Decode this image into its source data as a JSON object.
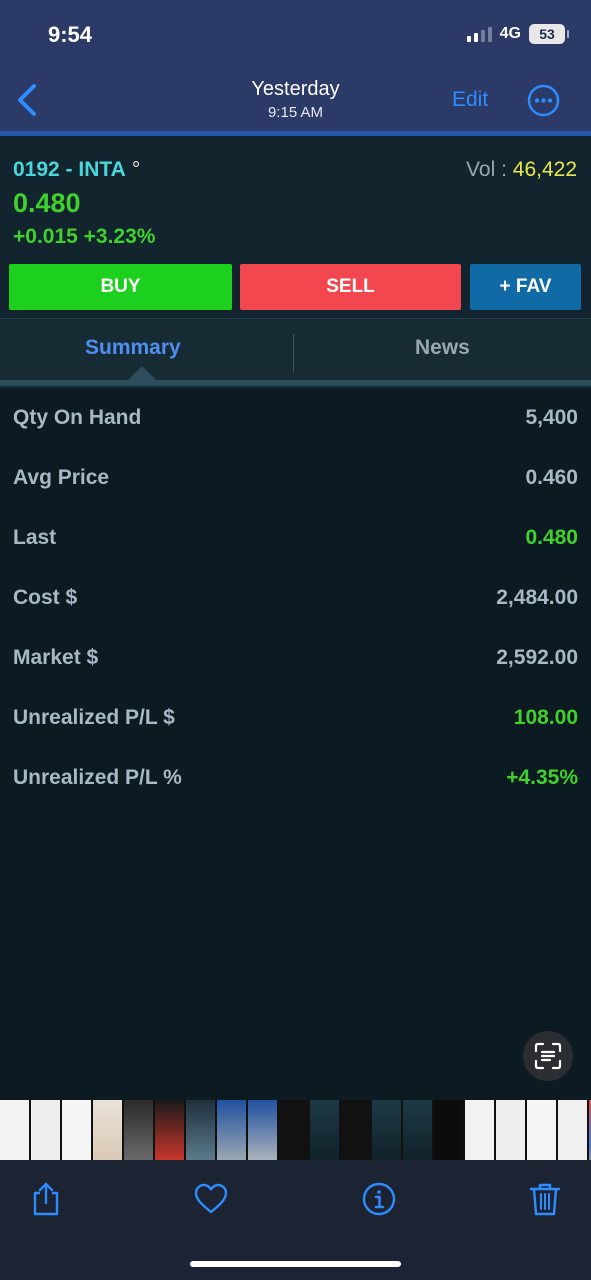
{
  "status_bar": {
    "time": "9:54",
    "network": "4G",
    "battery": "53"
  },
  "nav": {
    "title": "Yesterday",
    "subtitle": "9:15 AM",
    "edit_label": "Edit"
  },
  "quote": {
    "symbol": "0192 - INTA",
    "symbol_mark": "°",
    "vol_label": "Vol :",
    "vol_value": "46,422",
    "price": "0.480",
    "change": "+0.015 +3.23%"
  },
  "actions": {
    "buy": "BUY",
    "sell": "SELL",
    "fav": "+ FAV"
  },
  "tabs": {
    "summary": "Summary",
    "news": "News"
  },
  "summary": [
    {
      "label": "Qty On Hand",
      "value": "5,400",
      "positive": false
    },
    {
      "label": "Avg Price",
      "value": "0.460",
      "positive": false
    },
    {
      "label": "Last",
      "value": "0.480",
      "positive": true
    },
    {
      "label": "Cost $",
      "value": "2,484.00",
      "positive": false
    },
    {
      "label": "Market $",
      "value": "2,592.00",
      "positive": false
    },
    {
      "label": "Unrealized P/L $",
      "value": "108.00",
      "positive": true
    },
    {
      "label": "Unrealized P/L %",
      "value": "+4.35%",
      "positive": true
    }
  ],
  "toolbar_icons": [
    "share-icon",
    "heart-icon",
    "info-icon",
    "trash-icon"
  ],
  "colors": {
    "accent_blue": "#2d8cff",
    "gain_green": "#3fd12c",
    "sell_red": "#f2474f",
    "buy_green": "#1ed01e",
    "symbol_cyan": "#4ad7dc"
  }
}
